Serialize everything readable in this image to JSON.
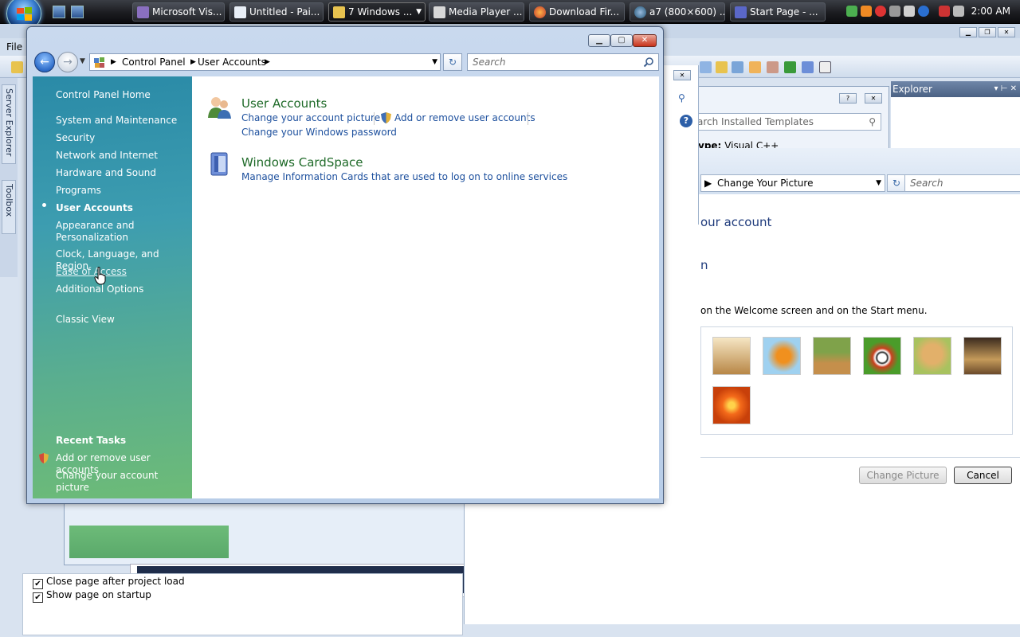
{
  "taskbar": {
    "tasks": [
      {
        "label": "Microsoft Vis..."
      },
      {
        "label": "Untitled - Pai..."
      },
      {
        "label": "7 Windows ..."
      },
      {
        "label": "Media Player ..."
      },
      {
        "label": "Download Fir..."
      },
      {
        "label": "a7 (800×600) ..."
      },
      {
        "label": "Start Page - ..."
      }
    ],
    "clock": "2:00 AM"
  },
  "ide": {
    "menu_file": "File",
    "side_tabs": [
      "Server Explorer",
      "Toolbox"
    ],
    "explorer_title": "Explorer",
    "start_options": [
      "Close page after project load",
      "Show page on startup"
    ]
  },
  "new_project": {
    "search_placeholder": "arch Installed Templates",
    "type_label": "ype:",
    "type_value": "Visual C++"
  },
  "change_picture": {
    "breadcrumb": "Change Your Picture",
    "search_placeholder": "Search",
    "heading": "our account",
    "heading2": "n",
    "description": "on the Welcome screen and on the Start menu.",
    "buttons": {
      "change": "Change Picture",
      "cancel": "Cancel"
    }
  },
  "control_panel": {
    "address": {
      "crumb1": "Control Panel",
      "crumb2": "User Accounts"
    },
    "search_placeholder": "Search",
    "sidebar": {
      "home": "Control Panel Home",
      "categories": [
        "System and Maintenance",
        "Security",
        "Network and Internet",
        "Hardware and Sound",
        "Programs",
        "User Accounts",
        "Appearance and",
        "Personalization",
        "Clock, Language, and Region",
        "Ease of Access",
        "Additional Options"
      ],
      "classic_view": "Classic View",
      "recent_tasks_title": "Recent Tasks",
      "recent_tasks": [
        "Add or remove user accounts",
        "Change your account picture"
      ]
    },
    "sections": [
      {
        "title": "User Accounts",
        "links": [
          "Change your account picture",
          "Add or remove user accounts",
          "Change your Windows password"
        ]
      },
      {
        "title": "Windows CardSpace",
        "links": [
          "Manage Information Cards that are used to log on to online services"
        ]
      }
    ]
  }
}
